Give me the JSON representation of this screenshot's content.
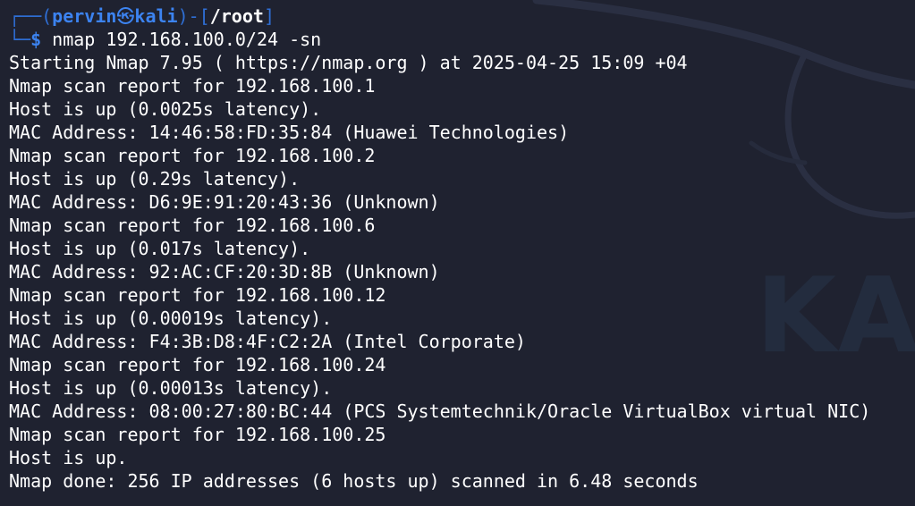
{
  "prompt": {
    "frame_top_left": "┌──(",
    "user": "pervin",
    "skull_icon": "㉿",
    "host": "kali",
    "frame_mid": ")-[",
    "path": "/root",
    "frame_close": "]",
    "frame_bottom_left": "└─",
    "dollar": "$",
    "command": " nmap 192.168.100.0/24 -sn"
  },
  "output_lines": [
    "Starting Nmap 7.95 ( https://nmap.org ) at 2025-04-25 15:09 +04",
    "Nmap scan report for 192.168.100.1",
    "Host is up (0.0025s latency).",
    "MAC Address: 14:46:58:FD:35:84 (Huawei Technologies)",
    "Nmap scan report for 192.168.100.2",
    "Host is up (0.29s latency).",
    "MAC Address: D6:9E:91:20:43:36 (Unknown)",
    "Nmap scan report for 192.168.100.6",
    "Host is up (0.017s latency).",
    "MAC Address: 92:AC:CF:20:3D:8B (Unknown)",
    "Nmap scan report for 192.168.100.12",
    "Host is up (0.00019s latency).",
    "MAC Address: F4:3B:D8:4F:C2:2A (Intel Corporate)",
    "Nmap scan report for 192.168.100.24",
    "Host is up (0.00013s latency).",
    "MAC Address: 08:00:27:80:BC:44 (PCS Systemtechnik/Oracle VirtualBox virtual NIC)",
    "Nmap scan report for 192.168.100.25",
    "Host is up.",
    "Nmap done: 256 IP addresses (6 hosts up) scanned in 6.48 seconds"
  ],
  "wallpaper": {
    "watermark": "KALI"
  },
  "colors": {
    "background": "#1f2230",
    "prompt_accent": "#3c83f0",
    "text": "#ffffff"
  }
}
